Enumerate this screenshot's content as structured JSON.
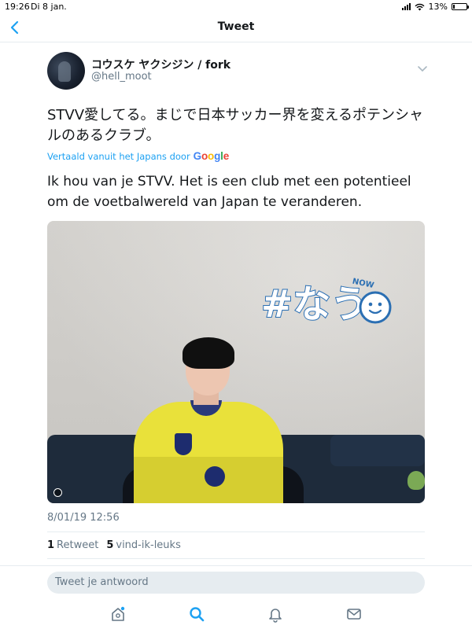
{
  "status_bar": {
    "time": "19:26",
    "date": "Di 8 jan.",
    "battery": "13%",
    "battery_level": 0.13
  },
  "nav": {
    "title": "Tweet",
    "back_icon": "chevron-left-icon"
  },
  "tweet": {
    "display_name": "コウスケ ヤクシジン / fork",
    "handle": "@hell_moot",
    "text": "STVV愛してる。まじで日本サッカー界を変えるポテンシャルのあるクラブ。",
    "translated_by": "Vertaald vanuit het Japans door",
    "google": "Google",
    "translation": "Ik hou van je STVV. Het is een club met een potentieel om de voetbalwereld van Japan te veranderen.",
    "photo_sticker": "#なう",
    "photo_sticker_small": "NOW",
    "timestamp": "8/01/19 12:56",
    "retweets_count": "1",
    "retweets_label": "Retweet",
    "likes_count": "5",
    "likes_label": "vind-ik-leuks"
  },
  "reply": {
    "placeholder": "Tweet je antwoord"
  },
  "tabs": [
    {
      "icon": "home-icon"
    },
    {
      "icon": "search-icon"
    },
    {
      "icon": "notifications-bell-icon"
    },
    {
      "icon": "messages-envelope-icon"
    }
  ],
  "colors": {
    "accent": "#1da1f2",
    "text": "#14171a",
    "secondary": "#657786",
    "divider": "#e6ecf0"
  }
}
